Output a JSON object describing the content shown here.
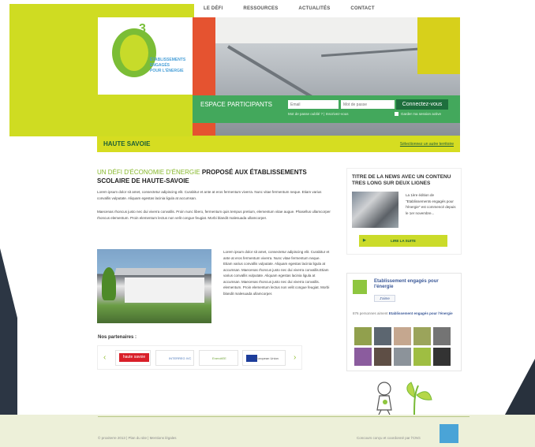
{
  "nav": {
    "items": [
      "LE DÉFI",
      "RESSOURCES",
      "ACTUALITÉS",
      "CONTACT"
    ]
  },
  "logo": {
    "number": "3",
    "lines": [
      "ÉTABLISSEMENTS",
      "ENGAGÉS",
      "POUR L'ÉNERGIE"
    ]
  },
  "participants": {
    "label": "ESPACE PARTICIPANTS",
    "email_placeholder": "Email",
    "password_placeholder": "Mot de passe",
    "connect": "Connectez-vous",
    "forgot": "Mot de passe oublié ?  |  Inscrivez-vous",
    "remember": "Garder ma session active"
  },
  "region": {
    "title": "HAUTE SAVOIE",
    "change": "Sélectionnez un autre territoire"
  },
  "main": {
    "title_green": "UN DÉFI D'ÉCONOMIE D'ÉNERGIE",
    "title_rest": "PROPOSÉ AUX ÉTABLISSEMENTS SCOLAIRE DE HAUTE-SAVOIE",
    "paragraph1": "Lorem ipsum dolor sit amet, consectetur adipiscing elit. Curabitur et ante at eros fermentum viverra. Nunc vitae fermentum neque. Etiam varius convallis vulputate. Aliquam egestas lacinia ligula at accumsan.",
    "paragraph2": "Maecenas rhoncus justo nec dui viverra convallis. Proin nunc libero, fermentum quis tempus pretium, elementum vitae augue. Phasellus ullamcorper rhoncus elementum. Proin elementum lectus non velit congue feugiat. Morbi blandit malesuada ullamcorper.",
    "side_text": "Lorem ipsum dolor sit amet, consectetur adipiscing elit. Curabitur et ante at eros fermentum viverra. Nunc vitae fermentum neque. Etiam varius convallis vulputate. Aliquam egestas lacinia ligula at accumsan. Maecenas rhoncus justo nec dui viverra convallis.Etiam varius convallis vulputate. Aliquam egestas lacinia ligula at accumsan. Maecenas rhoncus justo nec dui viverra convallis. elementum. Proin elementum lectus non velit congue feugiat. Morbi blandit malesuada ullamcorper."
  },
  "partners": {
    "title": "Nos partenaires :",
    "items": [
      "haute savoie",
      "INTERREG IVC",
      "EnercitEE",
      "European Union"
    ],
    "prev": "‹",
    "next": "›"
  },
  "news": {
    "title": "TITRE DE LA NEWS AVEC UN CONTENU TRES LONG SUR DEUX LIGNES",
    "text": "La 1ère édition de \"Etablissements engagés pour l'énergie\" est commencé depuis le 1er novembre...",
    "button": "LIRE LA SUITE"
  },
  "facebook": {
    "name": "Etablissement engagés pour l'énergie",
    "like": "J'aime",
    "count_prefix": "876 personnes aiment",
    "count_link": "Etablissement engagés pour l'énergie"
  },
  "footer": {
    "copy": "© proxiterre 2013  |  Plan du site  |  Mentions légales",
    "credit": "Concours conçu et coordonné par l'CNG"
  },
  "colors": {
    "lime": "#cfdc22",
    "green": "#43a85c",
    "dark_green": "#1e6f3d"
  }
}
